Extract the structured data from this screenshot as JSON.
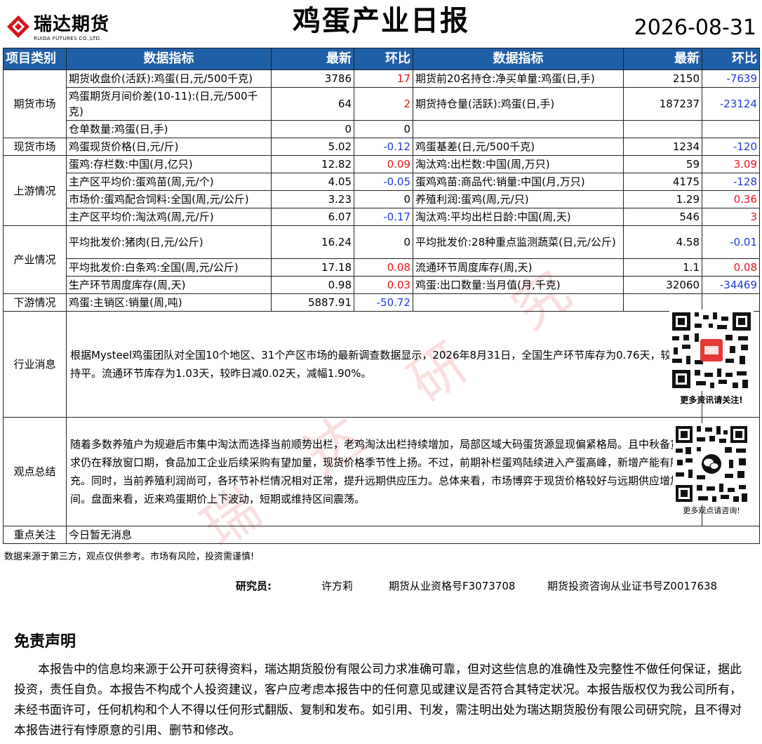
{
  "header": {
    "logo_cn": "瑞达期货",
    "logo_en": "RUIDA FUTURES CO.,LTD.",
    "title": "鸡蛋产业日报",
    "date": "2026-08-31"
  },
  "table_header": [
    "项目类别",
    "数据指标",
    "最新",
    "环比",
    "数据指标",
    "最新",
    "环比"
  ],
  "rows": {
    "r1": {
      "ind": "期货收盘价(活跃):鸡蛋(日,元/500千克)",
      "val": "3786",
      "chg": "17",
      "ind2": "期货前20名持仓:净买单量:鸡蛋(日,手)",
      "val2": "2150",
      "chg2": "-7639"
    },
    "r2": {
      "ind": "鸡蛋期货月间价差(10-11):(日,元/500千克)",
      "val": "64",
      "chg": "2",
      "ind2": "期货持仓量(活跃):鸡蛋(日,手)",
      "val2": "187237",
      "chg2": "-23124"
    },
    "r3": {
      "ind": "仓单数量:鸡蛋(日,手)",
      "val": "0",
      "chg": "0"
    },
    "r4": {
      "ind": "鸡蛋现货价格(日,元/斤)",
      "val": "5.02",
      "chg": "-0.12",
      "ind2": "鸡蛋基差(日,元/500千克)",
      "val2": "1234",
      "chg2": "-120"
    },
    "r5": {
      "ind": "蛋鸡:存栏数:中国(月,亿只)",
      "val": "12.82",
      "chg": "0.09",
      "ind2": "淘汰鸡:出栏数:中国(周,万只)",
      "val2": "59",
      "chg2": "3.09"
    },
    "r6": {
      "ind": "主产区平均价:蛋鸡苗(周,元/个)",
      "val": "4.05",
      "chg": "-0.05",
      "ind2": "蛋鸡鸡苗:商品代:销量:中国(月,万只)",
      "val2": "4175",
      "chg2": "-128"
    },
    "r7": {
      "ind": "市场价:蛋鸡配合饲料:全国(周,元/公斤)",
      "val": "3.23",
      "chg": "0",
      "ind2": "养殖利润:蛋鸡(周,元/只)",
      "val2": "1.29",
      "chg2": "0.36"
    },
    "r8": {
      "ind": "主产区平均价:淘汰鸡(周,元/斤)",
      "val": "6.07",
      "chg": "-0.17",
      "ind2": "淘汰鸡:平均出栏日龄:中国(周,天)",
      "val2": "546",
      "chg2": "3"
    },
    "r9": {
      "ind": "平均批发价:猪肉(日,元/公斤)",
      "val": "16.24",
      "chg": "0",
      "ind2": "平均批发价:28种重点监测蔬菜(日,元/公斤)",
      "val2": "4.58",
      "chg2": "-0.01"
    },
    "r10": {
      "ind": "平均批发价:白条鸡:全国(周,元/公斤)",
      "val": "17.18",
      "chg": "0.08",
      "ind2": "流通环节周度库存(周,天)",
      "val2": "1.1",
      "chg2": "0.08"
    },
    "r11": {
      "ind": "生产环节周度库存(周,天)",
      "val": "0.98",
      "chg": "0.03",
      "ind2": "鸡蛋:出口数量:当月值(月,千克)",
      "val2": "32060",
      "chg2": "-34469"
    },
    "r12": {
      "ind": "鸡蛋:主销区:销量(周,吨)",
      "val": "5887.91",
      "chg": "-50.72"
    }
  },
  "categories": {
    "futures": "期货市场",
    "spot": "现货市场",
    "upstream": "上游情况",
    "industry": "产业情况",
    "downstream": "下游情况",
    "news": "行业消息",
    "view": "观点总结",
    "focus": "重点关注"
  },
  "news_text": "根据Mysteel鸡蛋团队对全国10个地区、31个产区市场的最新调查数据显示，2026年8月31日，全国生产环节库存为0.76天，较昨日持平。流通环节库存为1.03天，较昨日减0.02天，减幅1.90%。",
  "view_text": "随着多数养殖户为规避后市集中淘汰而选择当前顺势出栏，老鸡淘汰出栏持续增加，局部区域大码蛋货源显现偏紧格局。且中秋备货需求仍在释放窗口期，食品加工企业后续采购有望加量，现货价格季节性上扬。不过，前期补栏蛋鸡陆续进入产蛋高峰，新增产能有所补充。同时，当前养殖利润尚可，各环节补栏情况相对正常，提升远期供应压力。总体来看，市场博弈于现货价格较好与远期供应增加之间。盘面来看，近来鸡蛋期价上下波动，短期或维持区间震荡。",
  "focus_text": "今日暂无消息",
  "qr1_caption": "更多资讯请关注!",
  "qr2_caption": "更多观点请咨询!",
  "note": "数据来源于第三方，观点仅供参考。市场有风险，投资需谨慎!",
  "researcher": {
    "label": "研究员:",
    "name": "许方莉",
    "license1": "期货从业资格号F3073708",
    "license2": "期货投资咨询从业证书号Z0017638"
  },
  "disclaimer": {
    "title": "免责声明",
    "body": "本报告中的信息均来源于公开可获得资料，瑞达期货股份有限公司力求准确可靠，但对这些信息的准确性及完整性不做任何保证，据此投资，责任自负。本报告不构成个人投资建议，客户应考虑本报告中的任何意见或建议是否符合其特定状况。本报告版权仅为我公司所有，未经书面许可，任何机构和个人不得以任何形式翻版、复制和发布。如引用、刊发，需注明出处为瑞达期货股份有限公司研究院，且不得对本报告进行有悖原意的引用、删节和修改。"
  },
  "watermark_text": "瑞达研究",
  "colors": {
    "header_bg": "#1f5fa8",
    "up": "#e8141a",
    "down": "#1f3bd9",
    "logo_red": "#d7141a"
  }
}
